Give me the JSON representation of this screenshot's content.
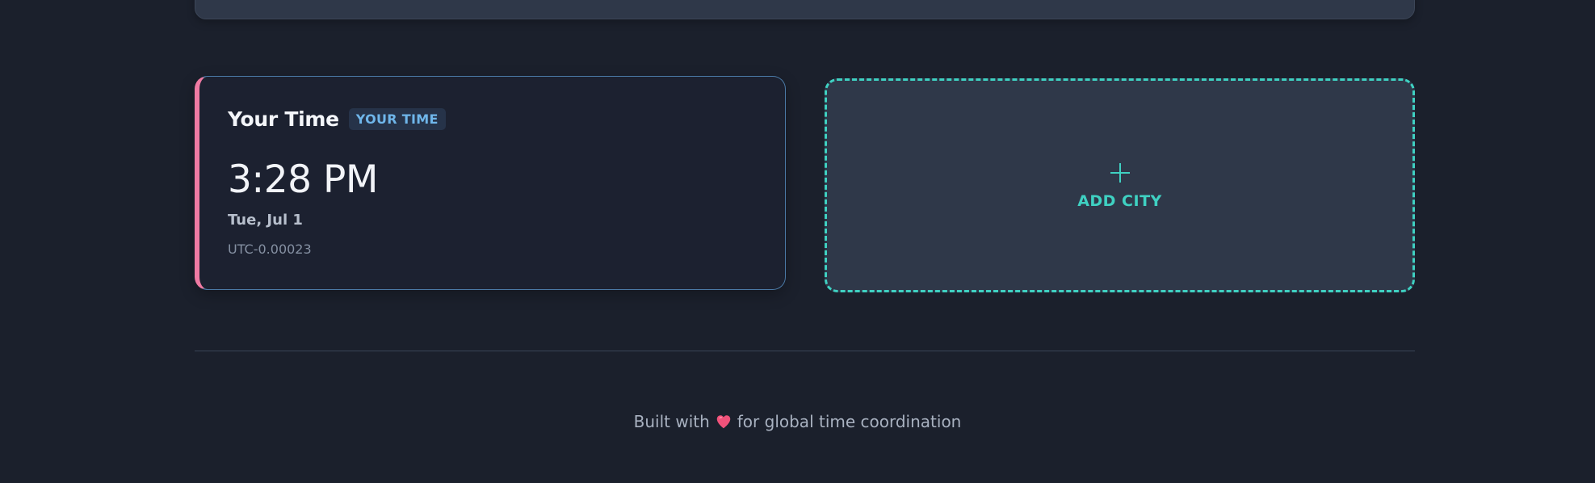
{
  "clock_card": {
    "title": "Your Time",
    "badge": "YOUR TIME",
    "time": "3:28 PM",
    "date": "Tue, Jul 1",
    "offset": "UTC-0.00023",
    "accent_color": "#ef7aa3"
  },
  "add_city": {
    "icon": "plus-icon",
    "label": "ADD CITY",
    "accent_color": "#3fd1c2"
  },
  "footer": {
    "prefix": "Built with",
    "icon": "heart-icon",
    "suffix": "for global time coordination"
  }
}
